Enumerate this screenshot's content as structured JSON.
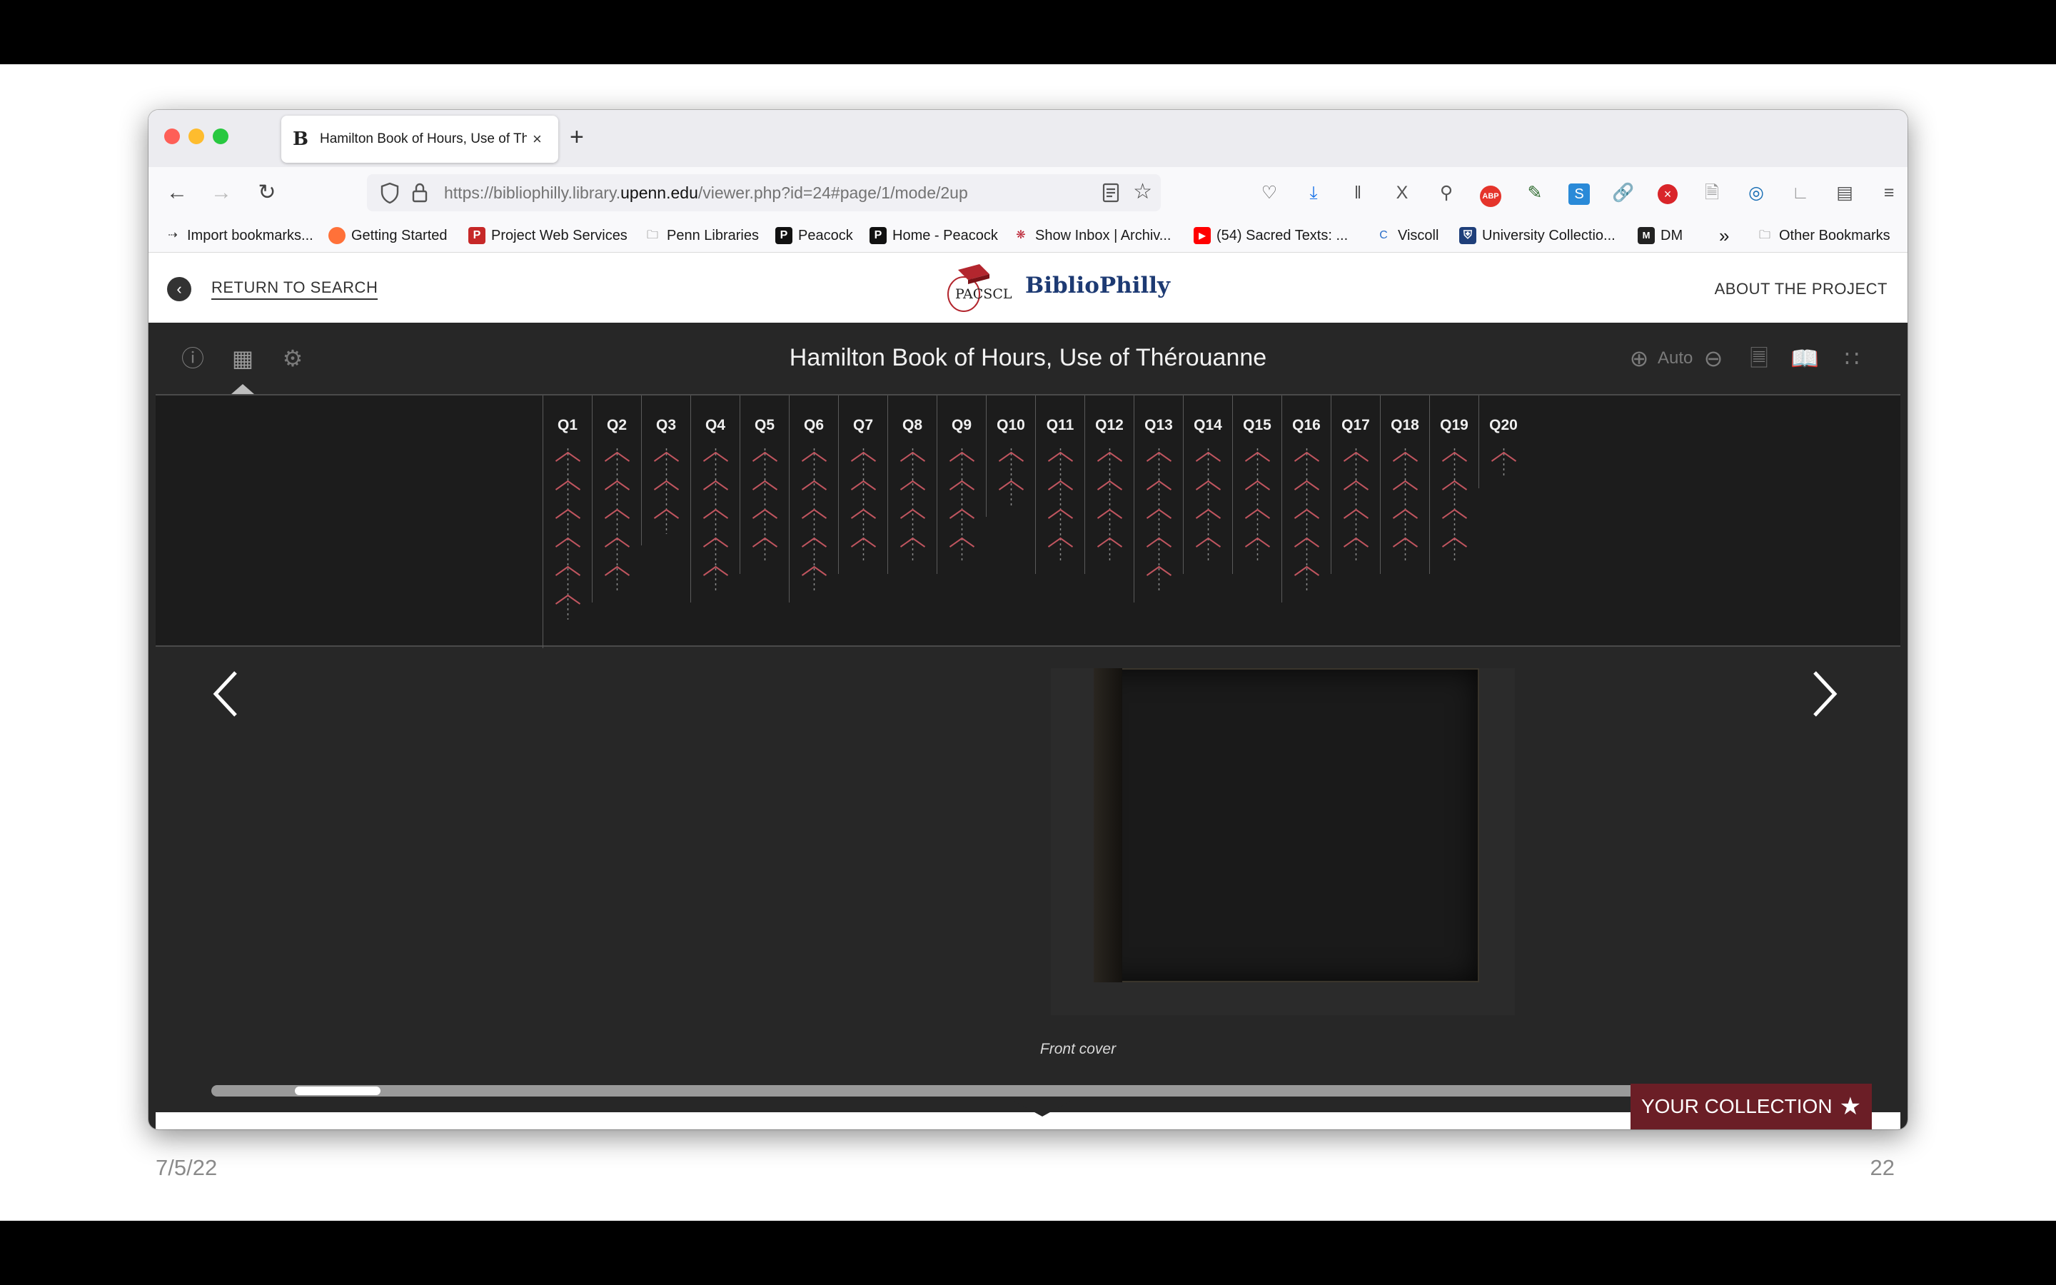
{
  "slide": {
    "date": "7/5/22",
    "page_number": "22"
  },
  "browser": {
    "tab": {
      "title": "Hamilton Book of Hours, Use of Thérouanne",
      "favicon": "B",
      "close": "×"
    },
    "new_tab": "+",
    "url": {
      "prefix": "https://bibliophilly.library.",
      "domain": "upenn.edu",
      "suffix": "/viewer.php?id=24#page/1/mode/2up"
    },
    "bookmarks": [
      {
        "label": "Import bookmarks...",
        "icon": "import-icon"
      },
      {
        "label": "Getting Started",
        "icon": "firefox-icon"
      },
      {
        "label": "Project Web Services",
        "icon": "p-red-icon"
      },
      {
        "label": "Penn Libraries",
        "icon": "folder-icon"
      },
      {
        "label": "Peacock",
        "icon": "p-black-icon"
      },
      {
        "label": "Home - Peacock",
        "icon": "p-black-icon"
      },
      {
        "label": "Show Inbox | Archiv...",
        "icon": "mail-icon"
      },
      {
        "label": "(54) Sacred Texts: ...",
        "icon": "youtube-icon"
      },
      {
        "label": "Viscoll",
        "icon": "viscoll-icon"
      },
      {
        "label": "University Collectio...",
        "icon": "shield-icon"
      },
      {
        "label": "DM",
        "icon": "dm-icon"
      },
      {
        "label": "»",
        "icon": "overflow-icon"
      },
      {
        "label": "Other Bookmarks",
        "icon": "folder-icon"
      }
    ]
  },
  "site": {
    "return_label": "RETURN TO SEARCH",
    "brand": "BiblioPhilly",
    "logo_text": "PACSCL",
    "about_label": "ABOUT THE PROJECT"
  },
  "viewer": {
    "title": "Hamilton Book of Hours, Use of Thérouanne",
    "zoom_label": "Auto",
    "quires": [
      {
        "label": "Q1",
        "leaves": 6
      },
      {
        "label": "Q2",
        "leaves": 5
      },
      {
        "label": "Q3",
        "leaves": 3
      },
      {
        "label": "Q4",
        "leaves": 5
      },
      {
        "label": "Q5",
        "leaves": 4
      },
      {
        "label": "Q6",
        "leaves": 5
      },
      {
        "label": "Q7",
        "leaves": 4
      },
      {
        "label": "Q8",
        "leaves": 4
      },
      {
        "label": "Q9",
        "leaves": 4
      },
      {
        "label": "Q10",
        "leaves": 2
      },
      {
        "label": "Q11",
        "leaves": 4
      },
      {
        "label": "Q12",
        "leaves": 4
      },
      {
        "label": "Q13",
        "leaves": 5
      },
      {
        "label": "Q14",
        "leaves": 4
      },
      {
        "label": "Q15",
        "leaves": 4
      },
      {
        "label": "Q16",
        "leaves": 5
      },
      {
        "label": "Q17",
        "leaves": 4
      },
      {
        "label": "Q18",
        "leaves": 4
      },
      {
        "label": "Q19",
        "leaves": 4
      },
      {
        "label": "Q20",
        "leaves": 1
      }
    ],
    "page_caption": "Front cover",
    "scrubber_progress": 0.05,
    "collection_label": "YOUR COLLECTION"
  },
  "colors": {
    "accent": "#6b1e26",
    "brand_blue": "#1d3a73",
    "leaf_red": "#c0555f"
  }
}
